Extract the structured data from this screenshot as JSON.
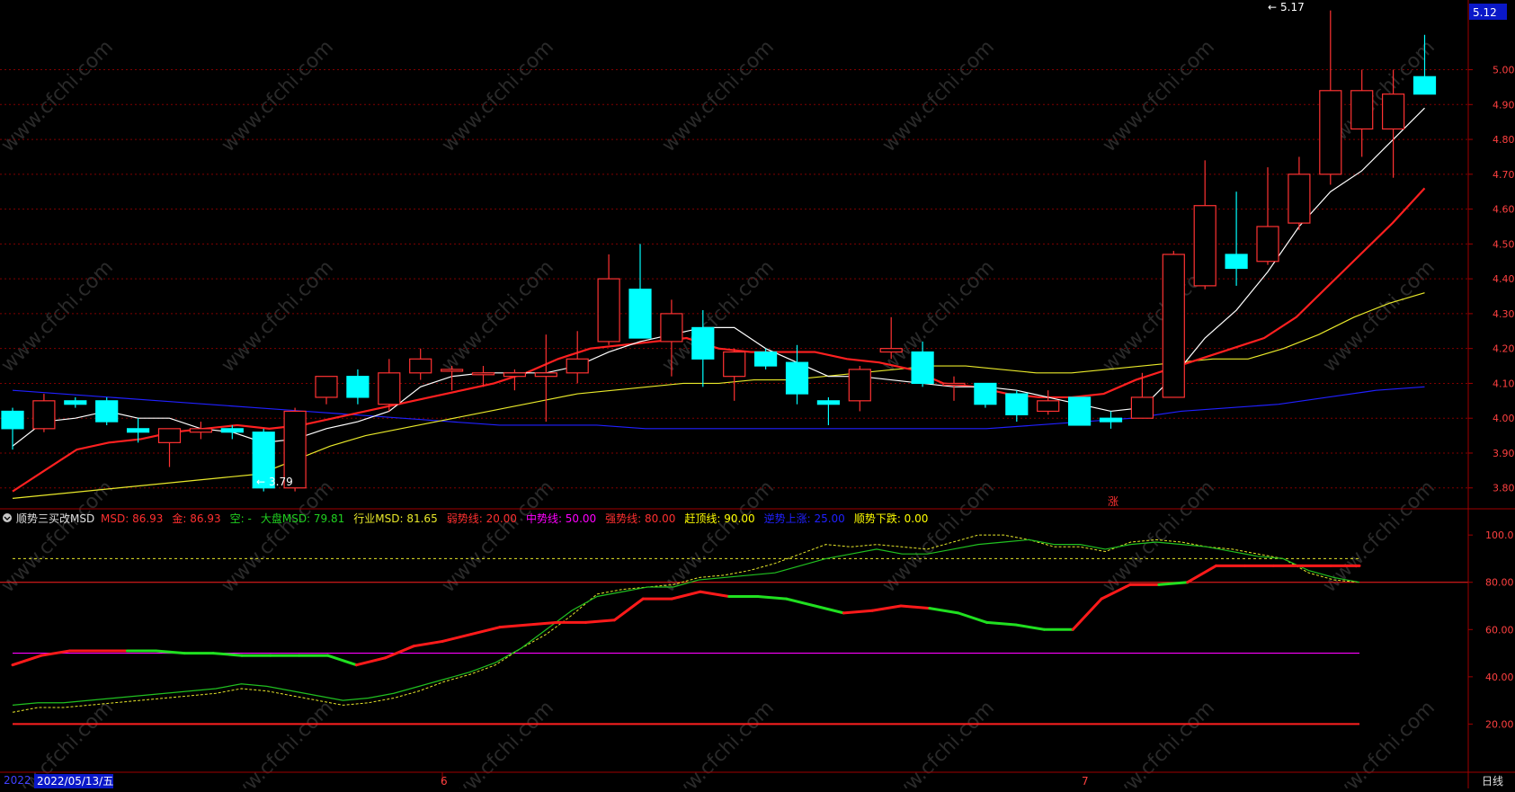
{
  "watermark": "www.cfchi.com",
  "colors": {
    "up": "#ff3232",
    "down": "#00ffff",
    "ma5": "#ffffff",
    "ma10": "#ff2020",
    "ma20": "#e8e82a",
    "ma60": "#2020ff",
    "grid": "#800000",
    "axis_text": "#ff4040",
    "price_badge_bg": "#0a18c8"
  },
  "price_axis": {
    "current_price_badge": "5.12",
    "ticks": [
      "5.00",
      "4.90",
      "4.80",
      "4.70",
      "4.60",
      "4.50",
      "4.40",
      "4.30",
      "4.20",
      "4.10",
      "4.00",
      "3.90",
      "3.80"
    ]
  },
  "annotations": {
    "high": "5.17",
    "low": "3.79",
    "high_arrow": "←",
    "low_arrow": "←",
    "zhang_mark": "涨"
  },
  "indicator_legend": {
    "name": "顺势三买改MSD",
    "items": [
      {
        "label": "MSD: 86.93",
        "color": "#ff3030"
      },
      {
        "label": "金: 86.93",
        "color": "#ff3030"
      },
      {
        "label": "空: -",
        "color": "#20d020"
      },
      {
        "label": "大盘MSD: 79.81",
        "color": "#20d020"
      },
      {
        "label": "行业MSD: 81.65",
        "color": "#e8e82a"
      },
      {
        "label": "弱势线: 20.00",
        "color": "#ff3030"
      },
      {
        "label": "中势线: 50.00",
        "color": "#ff00ff"
      },
      {
        "label": "强势线: 80.00",
        "color": "#ff3030"
      },
      {
        "label": "赶顶线: 90.00",
        "color": "#ffff00"
      },
      {
        "label": "逆势上涨: 25.00",
        "color": "#2020ff"
      },
      {
        "label": "顺势下跌: 0.00",
        "color": "#ffff00"
      }
    ]
  },
  "indicator_axis": {
    "ticks": [
      "100.0",
      "80.00",
      "60.00",
      "40.00",
      "20.00"
    ]
  },
  "date_axis": {
    "year_fragment": "2022",
    "cursor_date": "2022/05/13/五",
    "month_6": "6",
    "month_7": "7",
    "period": "日线"
  },
  "chart_data": {
    "type": "candlestick",
    "y_range": [
      3.74,
      5.2
    ],
    "candles": [
      {
        "o": 4.02,
        "h": 4.03,
        "l": 3.91,
        "c": 3.97
      },
      {
        "o": 3.97,
        "h": 4.07,
        "l": 3.96,
        "c": 4.05
      },
      {
        "o": 4.05,
        "h": 4.06,
        "l": 4.03,
        "c": 4.04
      },
      {
        "o": 4.05,
        "h": 4.06,
        "l": 3.98,
        "c": 3.99
      },
      {
        "o": 3.97,
        "h": 4.0,
        "l": 3.93,
        "c": 3.96
      },
      {
        "o": 3.93,
        "h": 3.97,
        "l": 3.86,
        "c": 3.97
      },
      {
        "o": 3.96,
        "h": 3.99,
        "l": 3.94,
        "c": 3.97
      },
      {
        "o": 3.97,
        "h": 3.98,
        "l": 3.94,
        "c": 3.96
      },
      {
        "o": 3.96,
        "h": 3.97,
        "l": 3.79,
        "c": 3.8
      },
      {
        "o": 3.8,
        "h": 4.03,
        "l": 3.79,
        "c": 4.02
      },
      {
        "o": 4.06,
        "h": 4.12,
        "l": 4.04,
        "c": 4.12
      },
      {
        "o": 4.12,
        "h": 4.14,
        "l": 4.04,
        "c": 4.06
      },
      {
        "o": 4.04,
        "h": 4.17,
        "l": 4.02,
        "c": 4.13
      },
      {
        "o": 4.13,
        "h": 4.2,
        "l": 4.11,
        "c": 4.17
      },
      {
        "o": 4.14,
        "h": 4.15,
        "l": 4.08,
        "c": 4.14
      },
      {
        "o": 4.13,
        "h": 4.15,
        "l": 4.09,
        "c": 4.13
      },
      {
        "o": 4.12,
        "h": 4.14,
        "l": 4.08,
        "c": 4.13
      },
      {
        "o": 4.12,
        "h": 4.24,
        "l": 3.99,
        "c": 4.13
      },
      {
        "o": 4.13,
        "h": 4.25,
        "l": 4.1,
        "c": 4.17
      },
      {
        "o": 4.22,
        "h": 4.47,
        "l": 4.21,
        "c": 4.4
      },
      {
        "o": 4.37,
        "h": 4.5,
        "l": 4.23,
        "c": 4.23
      },
      {
        "o": 4.22,
        "h": 4.34,
        "l": 4.12,
        "c": 4.3
      },
      {
        "o": 4.26,
        "h": 4.31,
        "l": 4.09,
        "c": 4.17
      },
      {
        "o": 4.12,
        "h": 4.2,
        "l": 4.05,
        "c": 4.19
      },
      {
        "o": 4.19,
        "h": 4.2,
        "l": 4.14,
        "c": 4.15
      },
      {
        "o": 4.16,
        "h": 4.21,
        "l": 4.04,
        "c": 4.07
      },
      {
        "o": 4.05,
        "h": 4.06,
        "l": 3.98,
        "c": 4.04
      },
      {
        "o": 4.05,
        "h": 4.15,
        "l": 4.02,
        "c": 4.14
      },
      {
        "o": 4.19,
        "h": 4.29,
        "l": 4.17,
        "c": 4.2
      },
      {
        "o": 4.19,
        "h": 4.22,
        "l": 4.09,
        "c": 4.1
      },
      {
        "o": 4.1,
        "h": 4.12,
        "l": 4.05,
        "c": 4.1
      },
      {
        "o": 4.1,
        "h": 4.1,
        "l": 4.03,
        "c": 4.04
      },
      {
        "o": 4.07,
        "h": 4.08,
        "l": 3.99,
        "c": 4.01
      },
      {
        "o": 4.02,
        "h": 4.08,
        "l": 4.01,
        "c": 4.05
      },
      {
        "o": 4.06,
        "h": 4.06,
        "l": 3.98,
        "c": 3.98
      },
      {
        "o": 4.0,
        "h": 4.02,
        "l": 3.97,
        "c": 3.99
      },
      {
        "o": 4.0,
        "h": 4.13,
        "l": 4.0,
        "c": 4.06
      },
      {
        "o": 4.06,
        "h": 4.48,
        "l": 4.06,
        "c": 4.47
      },
      {
        "o": 4.38,
        "h": 4.74,
        "l": 4.37,
        "c": 4.61
      },
      {
        "o": 4.47,
        "h": 4.65,
        "l": 4.38,
        "c": 4.43
      },
      {
        "o": 4.45,
        "h": 4.72,
        "l": 4.44,
        "c": 4.55
      },
      {
        "o": 4.56,
        "h": 4.75,
        "l": 4.54,
        "c": 4.7
      },
      {
        "o": 4.7,
        "h": 5.17,
        "l": 4.67,
        "c": 4.94
      },
      {
        "o": 4.83,
        "h": 5.0,
        "l": 4.75,
        "c": 4.94
      },
      {
        "o": 4.83,
        "h": 5.0,
        "l": 4.69,
        "c": 4.93
      },
      {
        "o": 4.98,
        "h": 5.1,
        "l": 4.93,
        "c": 4.93
      }
    ],
    "ma5": [
      3.92,
      3.99,
      4.0,
      4.02,
      4.0,
      4.0,
      3.97,
      3.96,
      3.93,
      3.94,
      3.97,
      3.99,
      4.02,
      4.09,
      4.12,
      4.13,
      4.13,
      4.13,
      4.15,
      4.19,
      4.22,
      4.24,
      4.26,
      4.26,
      4.2,
      4.16,
      4.12,
      4.12,
      4.11,
      4.1,
      4.09,
      4.09,
      4.08,
      4.06,
      4.04,
      4.02,
      4.03,
      4.12,
      4.23,
      4.31,
      4.42,
      4.55,
      4.65,
      4.71,
      4.8,
      4.89
    ],
    "ma10": [
      3.79,
      3.85,
      3.91,
      3.93,
      3.94,
      3.96,
      3.97,
      3.98,
      3.97,
      3.98,
      4.0,
      4.02,
      4.04,
      4.06,
      4.08,
      4.1,
      4.13,
      4.17,
      4.2,
      4.21,
      4.22,
      4.23,
      4.2,
      4.19,
      4.19,
      4.19,
      4.17,
      4.16,
      4.14,
      4.1,
      4.09,
      4.07,
      4.06,
      4.06,
      4.07,
      4.11,
      4.14,
      4.17,
      4.2,
      4.23,
      4.29,
      4.38,
      4.47,
      4.56,
      4.66
    ],
    "ma20": [
      3.77,
      3.78,
      3.79,
      3.8,
      3.81,
      3.82,
      3.83,
      3.84,
      3.88,
      3.92,
      3.95,
      3.97,
      3.99,
      4.01,
      4.03,
      4.05,
      4.07,
      4.08,
      4.09,
      4.1,
      4.1,
      4.11,
      4.11,
      4.12,
      4.13,
      4.14,
      4.15,
      4.15,
      4.14,
      4.13,
      4.13,
      4.14,
      4.15,
      4.16,
      4.17,
      4.17,
      4.2,
      4.24,
      4.29,
      4.33,
      4.36
    ],
    "ma60": [
      4.08,
      4.07,
      4.06,
      4.05,
      4.04,
      4.03,
      4.02,
      4.01,
      4.0,
      3.99,
      3.98,
      3.98,
      3.98,
      3.97,
      3.97,
      3.97,
      3.97,
      3.97,
      3.97,
      3.97,
      3.97,
      3.98,
      3.99,
      4.0,
      4.02,
      4.03,
      4.04,
      4.06,
      4.08,
      4.09
    ],
    "indicator": {
      "y_range": [
        0,
        105
      ],
      "msd": [
        45,
        49,
        51,
        51,
        51,
        51,
        50,
        50,
        49,
        49,
        49,
        49,
        45,
        48,
        53,
        55,
        58,
        61,
        62,
        63,
        63,
        64,
        73,
        73,
        76,
        74,
        74,
        73,
        70,
        67,
        68,
        70,
        69,
        67,
        63,
        62,
        60,
        60,
        73,
        79,
        79,
        80,
        87,
        87,
        87,
        87,
        87,
        87
      ],
      "msd_up": [
        true,
        true,
        true,
        true,
        false,
        false,
        false,
        false,
        false,
        false,
        false,
        false,
        true,
        true,
        true,
        true,
        true,
        true,
        true,
        true,
        true,
        true,
        true,
        true,
        true,
        false,
        false,
        false,
        false,
        true,
        true,
        true,
        false,
        false,
        false,
        false,
        false,
        true,
        true,
        true,
        false,
        true,
        true,
        true,
        true,
        true,
        true,
        true
      ],
      "market_msd": [
        28,
        29,
        29,
        30,
        31,
        32,
        33,
        34,
        35,
        37,
        36,
        34,
        32,
        30,
        31,
        33,
        36,
        39,
        42,
        46,
        52,
        60,
        68,
        74,
        76,
        78,
        78,
        81,
        82,
        83,
        84,
        87,
        90,
        92,
        94,
        92,
        92,
        94,
        96,
        97,
        98,
        96,
        96,
        94,
        96,
        97,
        96,
        95,
        93,
        91,
        90,
        85,
        82,
        80
      ],
      "sector_msd": [
        25,
        27,
        27,
        28,
        29,
        30,
        31,
        32,
        33,
        35,
        34,
        32,
        30,
        28,
        29,
        31,
        34,
        38,
        41,
        45,
        52,
        58,
        66,
        75,
        77,
        78,
        79,
        82,
        83,
        85,
        88,
        92,
        96,
        95,
        96,
        95,
        94,
        97,
        100,
        100,
        98,
        95,
        95,
        93,
        97,
        98,
        97,
        95,
        94,
        92,
        90,
        84,
        81,
        80
      ],
      "levels": {
        "weak": 20,
        "middle": 50,
        "strong": 80,
        "top": 90
      }
    }
  }
}
